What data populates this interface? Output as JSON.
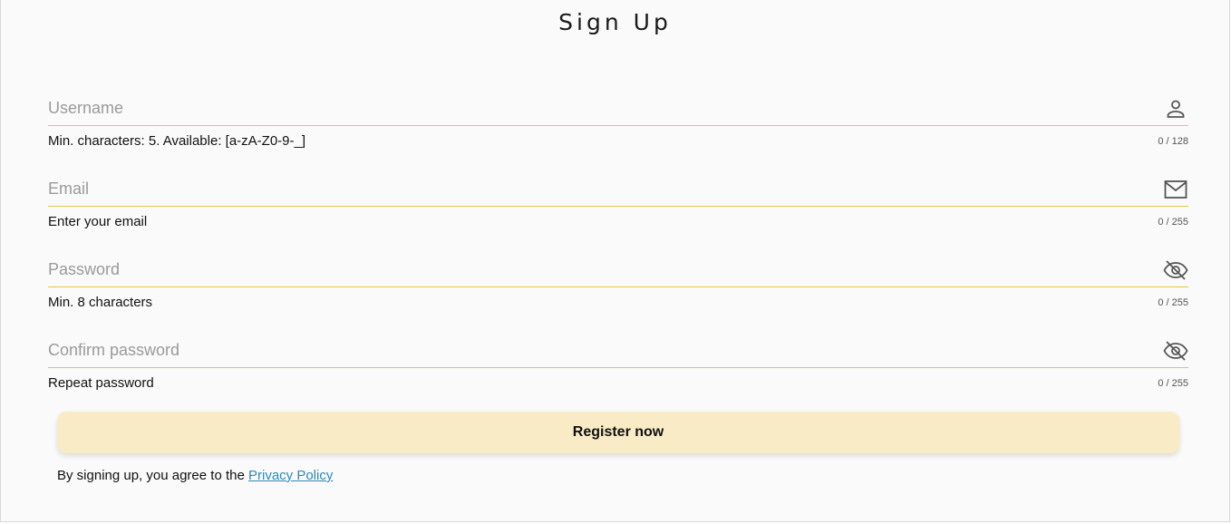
{
  "form": {
    "title": "Sign Up",
    "fields": [
      {
        "placeholder": "Username",
        "value": "",
        "icon": "person-icon",
        "hint": "Min. characters: 5. Available: [a-zA-Z0-9-_]",
        "counter": "0 / 128"
      },
      {
        "placeholder": "Email",
        "value": "",
        "icon": "mail-icon",
        "hint": "Enter your email",
        "counter": "0 / 255"
      },
      {
        "placeholder": "Password",
        "value": "",
        "icon": "eye-off-icon",
        "hint": "Min. 8 characters",
        "counter": "0 / 255"
      },
      {
        "placeholder": "Confirm password",
        "value": "",
        "icon": "eye-off-icon",
        "hint": "Repeat password",
        "counter": "0 / 255"
      }
    ],
    "register_label": "Register now",
    "agree_text": "By signing up, you agree to the ",
    "privacy_link": "Privacy Policy"
  },
  "colors": {
    "underline": "#e8c547",
    "button_bg": "#f8ebc6",
    "link": "#2a8ab8"
  }
}
